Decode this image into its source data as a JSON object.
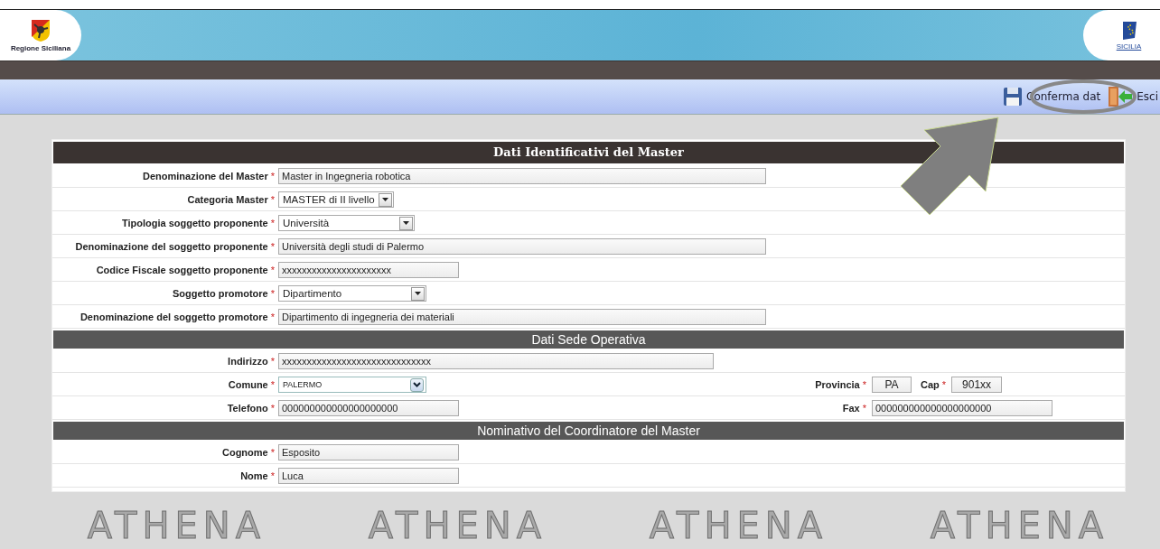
{
  "header": {
    "region_logo_caption": "Regione Siciliana",
    "brand_logo_caption": "SICILIA"
  },
  "toolbar": {
    "buttons": [
      {
        "kind": "save",
        "label": "Conferma dat"
      },
      {
        "kind": "exit",
        "label": "Esci"
      }
    ]
  },
  "form": {
    "sections": [
      {
        "kind": "main",
        "title": "Dati Identificativi del Master",
        "rows": [
          {
            "label": "Denominazione del Master",
            "mark": "*",
            "control": {
              "kind": "text",
              "value": "Master in Ingegneria robotica"
            }
          },
          {
            "label": "Categoria Master",
            "mark": "*",
            "control": {
              "kind": "select",
              "value": "MASTER di II livello"
            }
          },
          {
            "label": "Tipologia soggetto proponente",
            "mark": "*",
            "control": {
              "kind": "select",
              "value": "Università"
            }
          },
          {
            "label": "Denominazione del soggetto proponente",
            "mark": "*",
            "control": {
              "kind": "text",
              "value": "Università degli studi di Palermo"
            }
          },
          {
            "label": "Codice Fiscale soggetto proponente",
            "mark": "*",
            "control": {
              "kind": "text",
              "value": "xxxxxxxxxxxxxxxxxxxxxx"
            }
          },
          {
            "label": "Soggetto promotore",
            "mark": "*",
            "control": {
              "kind": "select",
              "value": "Dipartimento"
            }
          },
          {
            "label": "Denominazione del soggetto promotore",
            "mark": "*",
            "control": {
              "kind": "text",
              "value": "Dipartimento di ingegneria dei materiali"
            }
          }
        ]
      },
      {
        "kind": "sub",
        "title": "Dati Sede Operativa",
        "rows": [
          {
            "label": "Indirizzo",
            "mark": "*",
            "control": {
              "kind": "text",
              "value": "xxxxxxxxxxxxxxxxxxxxxxxxxxxxxx"
            }
          },
          {
            "label": "Comune",
            "mark": "*",
            "control": {
              "kind": "dropdown",
              "value": "PALERMO"
            },
            "extra": [
              {
                "label": "Provincia",
                "mark": "*",
                "control": {
                  "kind": "text",
                  "value": "PA"
                }
              },
              {
                "label": "Cap",
                "mark": "*",
                "control": {
                  "kind": "text",
                  "value": "901xx"
                }
              }
            ]
          },
          {
            "label": "Telefono",
            "mark": "*",
            "control": {
              "kind": "text",
              "value": "000000000000000000000"
            },
            "extra": [
              {
                "label": "Fax",
                "mark": "*",
                "control": {
                  "kind": "text",
                  "value": "000000000000000000000"
                }
              }
            ]
          }
        ]
      },
      {
        "kind": "sub",
        "title": "Nominativo del Coordinatore del Master",
        "rows": [
          {
            "label": "Cognome",
            "mark": "*",
            "control": {
              "kind": "text",
              "value": "Esposito"
            }
          },
          {
            "label": "Nome",
            "mark": "*",
            "control": {
              "kind": "text",
              "value": "Luca"
            }
          }
        ]
      }
    ]
  },
  "background_marks": [
    "ATHENA",
    "ATHENA",
    "ATHENA",
    "ATHENA"
  ]
}
